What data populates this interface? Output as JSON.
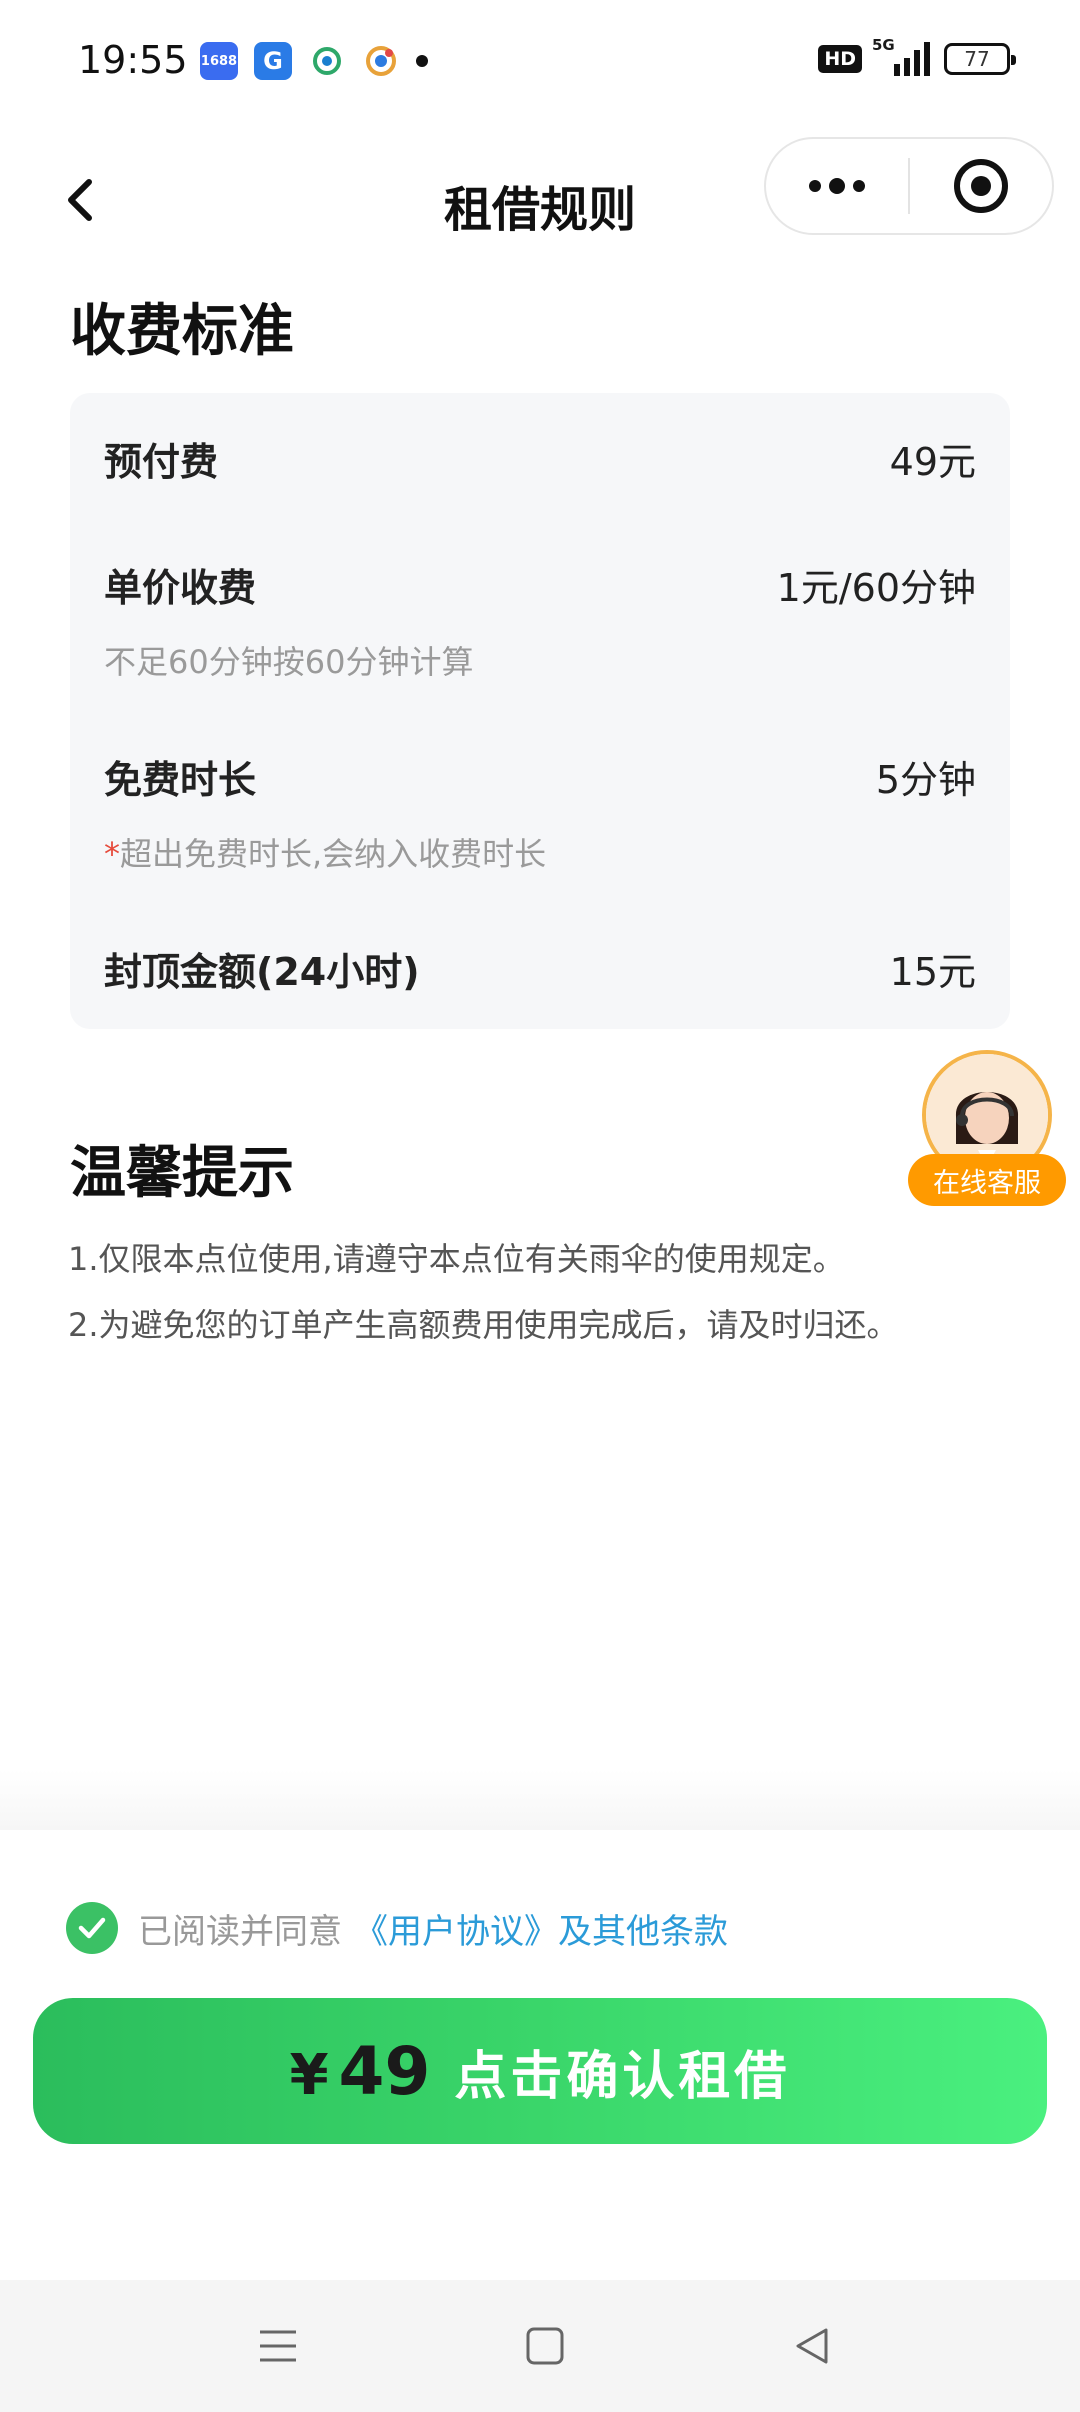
{
  "status_bar": {
    "time": "19:55",
    "notif_icons": [
      "1688-app-icon",
      "g-app-icon",
      "mobile-carrier-icon",
      "colorful-app-icon"
    ],
    "hd": "HD",
    "network": "5G",
    "battery": "77"
  },
  "header": {
    "title": "租借规则",
    "back_icon": "chevron-left-icon",
    "more_icon": "more-dots-icon",
    "close_icon": "target-close-icon"
  },
  "fee_section": {
    "title": "收费标准",
    "rows": [
      {
        "label": "预付费",
        "value": "49元"
      },
      {
        "label": "单价收费",
        "value": "1元/60分钟",
        "note": "不足60分钟按60分钟计算"
      },
      {
        "label": "免费时长",
        "value": "5分钟",
        "note_prefix": "*",
        "note": "超出免费时长,会纳入收费时长"
      },
      {
        "label": "封顶金额(24小时)",
        "value": "15元"
      }
    ]
  },
  "tips_section": {
    "title": "温馨提示",
    "lines": [
      "1.仅限本点位使用,请遵守本点位有关雨伞的使用规定。",
      "2.为避免您的订单产生高额费用使用完成后，请及时归还。"
    ]
  },
  "customer_service": {
    "label": "在线客服"
  },
  "agreement": {
    "prefix": "已阅读并同意",
    "link": "《用户协议》及其他条款",
    "checked": true
  },
  "confirm": {
    "currency": "¥",
    "amount": "49",
    "label": "点击确认租借"
  },
  "colors": {
    "accent_green": "#3bc165",
    "link_blue": "#2b9bd8",
    "cs_orange": "#ff9a00"
  }
}
